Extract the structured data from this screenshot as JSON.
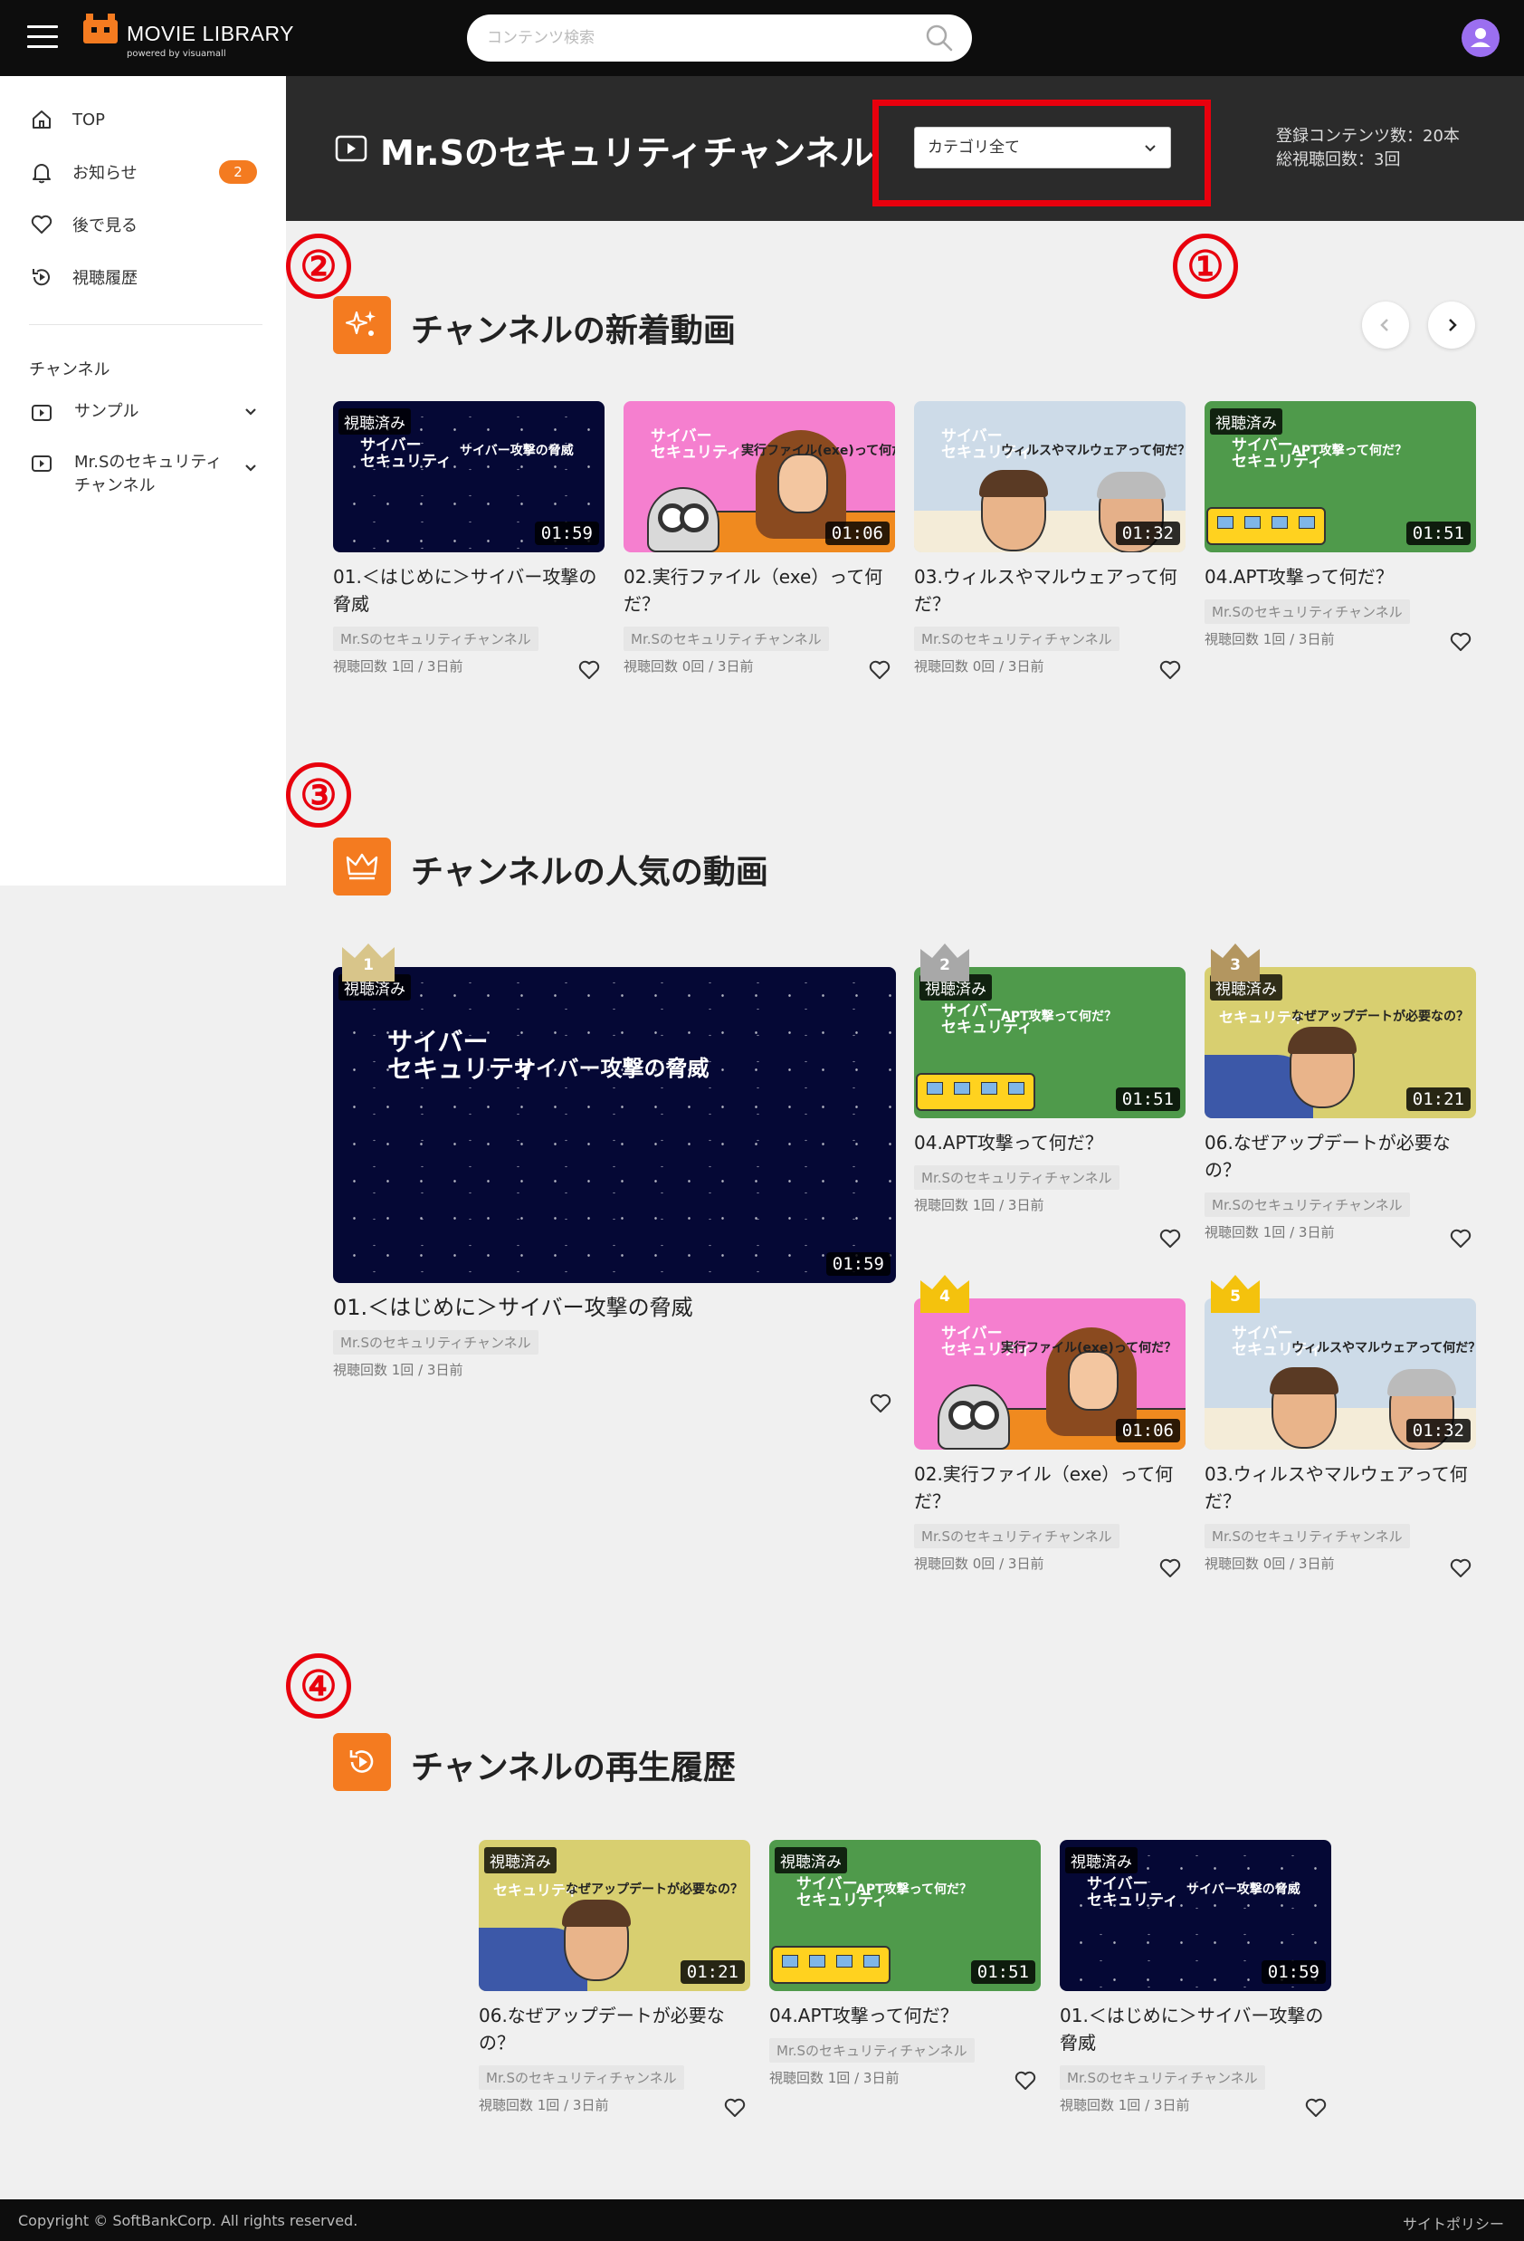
{
  "app": {
    "title": "MOVIE LIBRARY",
    "subtitle": "powered by visuamall"
  },
  "search": {
    "placeholder": "コンテンツ検索"
  },
  "sidebar": {
    "items": [
      {
        "label": "TOP",
        "icon": "home-icon"
      },
      {
        "label": "お知らせ",
        "icon": "bell-icon",
        "badge": "2"
      },
      {
        "label": "後で見る",
        "icon": "heart-icon"
      },
      {
        "label": "視聴履歴",
        "icon": "history-icon"
      }
    ],
    "section_label": "チャンネル",
    "channels": [
      {
        "label": "サンプル",
        "icon": "video-icon"
      },
      {
        "label": "Mr.Sのセキュリティチャンネル",
        "icon": "video-icon"
      }
    ]
  },
  "channel": {
    "title": "Mr.Sのセキュリティチャンネル",
    "category_select": "カテゴリ全て",
    "stats_contents": "登録コンテンツ数：20本",
    "stats_views": "総視聴回数：3回"
  },
  "annotations": [
    "①",
    "②",
    "③",
    "④"
  ],
  "colors": {
    "accent": "#f47b20",
    "annotation_red": "#e8000d",
    "header_bg": "#0d0d0d",
    "channel_header_bg": "#2b2b2b"
  },
  "sections": {
    "new": {
      "title": "チャンネルの新着動画",
      "videos": [
        {
          "title": "01.＜はじめに＞サイバー攻撃の脅威",
          "duration": "01:59",
          "watched": "視聴済み",
          "channel": "Mr.Sのセキュリティチャンネル",
          "meta": "視聴回数 1回 /  3日前",
          "thumb_line1": "サイバー\nセキュリティ",
          "thumb_line2": "サイバー攻撃の脅威"
        },
        {
          "title": "02.実行ファイル（exe）って何だ？",
          "duration": "01:06",
          "channel": "Mr.Sのセキュリティチャンネル",
          "meta": "視聴回数 0回 /  3日前",
          "thumb_line1": "サイバー\nセキュリティ",
          "thumb_line2": "実行ファイル(exe)って何だ？"
        },
        {
          "title": "03.ウィルスやマルウェアって何だ？",
          "duration": "01:32",
          "channel": "Mr.Sのセキュリティチャンネル",
          "meta": "視聴回数 0回 /  3日前",
          "thumb_line1": "サイバー\nセキュリティ",
          "thumb_line2": "ウィルスやマルウェアって何だ？"
        },
        {
          "title": "04.APT攻撃って何だ？",
          "duration": "01:51",
          "watched": "視聴済み",
          "channel": "Mr.Sのセキュリティチャンネル",
          "meta": "視聴回数 1回 /  3日前",
          "thumb_line1": "サイバー\nセキュリティ",
          "thumb_line2": "APT攻撃って何だ？"
        }
      ]
    },
    "popular": {
      "title": "チャンネルの人気の動画",
      "videos": [
        {
          "rank": "1",
          "title": "01.＜はじめに＞サイバー攻撃の脅威",
          "duration": "01:59",
          "watched": "視聴済み",
          "channel": "Mr.Sのセキュリティチャンネル",
          "meta": "視聴回数 1回 /  3日前",
          "thumb_line1": "サイバー\nセキュリティ",
          "thumb_line2": "サイバー攻撃の脅威"
        },
        {
          "rank": "2",
          "title": "04.APT攻撃って何だ？",
          "duration": "01:51",
          "watched": "視聴済み",
          "channel": "Mr.Sのセキュリティチャンネル",
          "meta": "視聴回数 1回 /  3日前",
          "thumb_line1": "サイバー\nセキュリティ",
          "thumb_line2": "APT攻撃って何だ？"
        },
        {
          "rank": "3",
          "title": "06.なぜアップデートが必要なの？",
          "duration": "01:21",
          "watched": "視聴済み",
          "channel": "Mr.Sのセキュリティチャンネル",
          "meta": "視聴回数 1回 /  3日前",
          "thumb_line1": "セキュリティ",
          "thumb_line2": "なぜアップデートが必要なの？"
        },
        {
          "rank": "4",
          "title": "02.実行ファイル（exe）って何だ？",
          "duration": "01:06",
          "channel": "Mr.Sのセキュリティチャンネル",
          "meta": "視聴回数 0回 /  3日前",
          "thumb_line1": "サイバー\nセキュリティ",
          "thumb_line2": "実行ファイル(exe)って何だ？"
        },
        {
          "rank": "5",
          "title": "03.ウィルスやマルウェアって何だ？",
          "duration": "01:32",
          "channel": "Mr.Sのセキュリティチャンネル",
          "meta": "視聴回数 0回 /  3日前",
          "thumb_line1": "サイバー\nセキュリティ",
          "thumb_line2": "ウィルスやマルウェアって何だ？"
        }
      ]
    },
    "history": {
      "title": "チャンネルの再生履歴",
      "videos": [
        {
          "title": "06.なぜアップデートが必要なの？",
          "duration": "01:21",
          "watched": "視聴済み",
          "channel": "Mr.Sのセキュリティチャンネル",
          "meta": "視聴回数 1回 /  3日前",
          "thumb_line1": "セキュリティ",
          "thumb_line2": "なぜアップデートが必要なの？"
        },
        {
          "title": "04.APT攻撃って何だ？",
          "duration": "01:51",
          "watched": "視聴済み",
          "channel": "Mr.Sのセキュリティチャンネル",
          "meta": "視聴回数 1回 /  3日前",
          "thumb_line1": "サイバー\nセキュリティ",
          "thumb_line2": "APT攻撃って何だ？"
        },
        {
          "title": "01.＜はじめに＞サイバー攻撃の脅威",
          "duration": "01:59",
          "watched": "視聴済み",
          "channel": "Mr.Sのセキュリティチャンネル",
          "meta": "視聴回数 1回 /  3日前",
          "thumb_line1": "サイバー\nセキュリティ",
          "thumb_line2": "サイバー攻撃の脅威"
        }
      ]
    }
  },
  "footer": {
    "copyright": "Copyright © SoftBankCorp. All rights reserved.",
    "policy": "サイトポリシー"
  }
}
